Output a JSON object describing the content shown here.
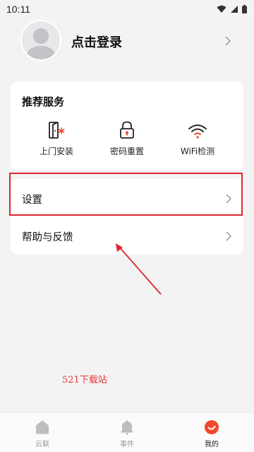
{
  "status_bar": {
    "time": "10:11"
  },
  "profile": {
    "login_label": "点击登录"
  },
  "services": {
    "title": "推荐服务",
    "items": [
      {
        "label": "上门安装",
        "icon": "door-install-icon"
      },
      {
        "label": "密码重置",
        "icon": "lock-icon"
      },
      {
        "label": "WiFi检测",
        "icon": "wifi-icon"
      }
    ]
  },
  "menu": {
    "items": [
      {
        "label": "设置"
      },
      {
        "label": "帮助与反馈"
      }
    ]
  },
  "watermark": "521下载站",
  "tabs": [
    {
      "label": "云联",
      "icon": "home-icon",
      "active": false
    },
    {
      "label": "事件",
      "icon": "bell-icon",
      "active": false
    },
    {
      "label": "我的",
      "icon": "profile-icon",
      "active": true
    }
  ],
  "colors": {
    "accent": "#f04a2e",
    "highlight": "#e0262f"
  }
}
